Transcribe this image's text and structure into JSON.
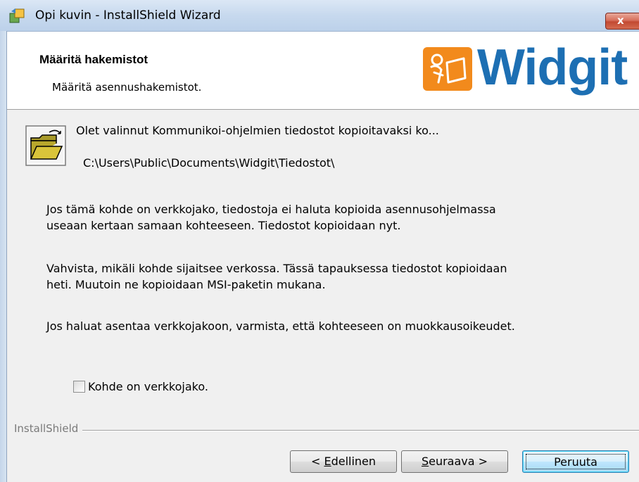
{
  "window": {
    "title": "Opi kuvin - InstallShield Wizard",
    "close_glyph": "x"
  },
  "header": {
    "title": "Määritä hakemistot",
    "subtitle": "Määritä asennushakemistot.",
    "logo_text": "Widgit",
    "logo_color": "#1d6fb3",
    "logo_accent": "#f28a1c"
  },
  "body": {
    "info_line": "Olet valinnut Kommunikoi-ohjelmien tiedostot kopioitavaksi ko...",
    "path": "C:\\Users\\Public\\Documents\\Widgit\\Tiedostot\\",
    "paragraphs": [
      "Jos tämä kohde on verkkojako, tiedostoja ei haluta kopioida asennusohjelmassa useaan kertaan samaan kohteeseen. Tiedostot kopioidaan nyt.",
      "Vahvista, mikäli kohde sijaitsee verkossa. Tässä tapauksessa tiedostot kopioidaan heti. Muutoin ne kopioidaan MSI-paketin mukana.",
      "Jos haluat asentaa verkkojakoon, varmista, että kohteeseen on muokkausoikeudet."
    ],
    "checkbox": {
      "label": "Kohde on verkkojako.",
      "checked": false
    }
  },
  "footer": {
    "brand": "InstallShield",
    "buttons": {
      "back": {
        "prefix": "< ",
        "mnemonic": "E",
        "rest": "dellinen"
      },
      "next": {
        "mnemonic": "S",
        "rest": "euraava >"
      },
      "cancel": "Peruuta"
    }
  }
}
